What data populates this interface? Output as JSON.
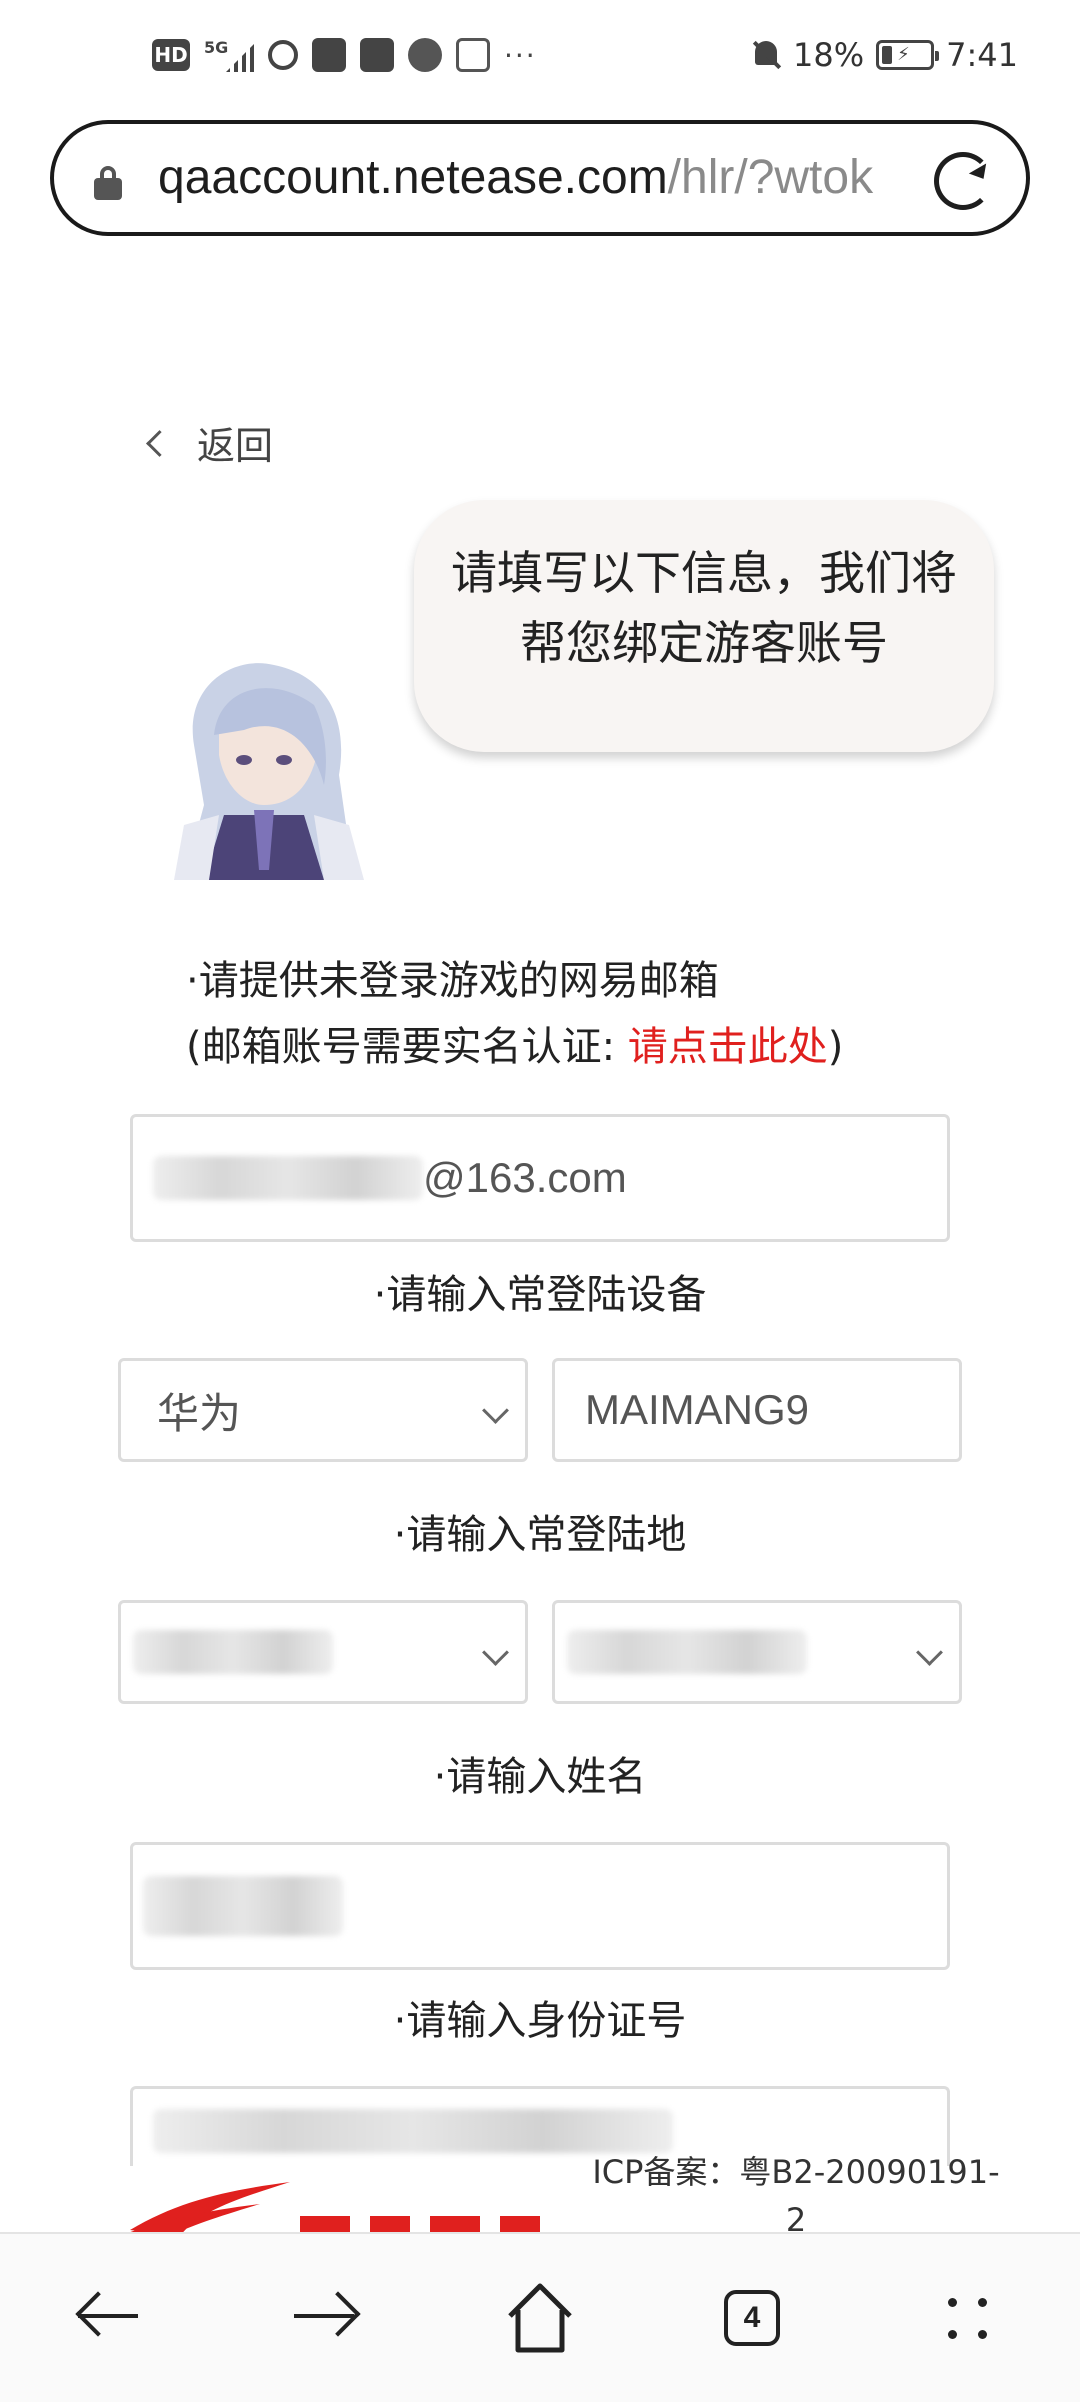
{
  "status_bar": {
    "battery": "18%",
    "time": "7:41",
    "network": "5G",
    "hd": "HD",
    "more": "···"
  },
  "browser": {
    "url_host": "qaaccount.netease.com",
    "url_path": "/hlr/?wtok",
    "tab_count": "4"
  },
  "page": {
    "back_label": "返回",
    "bubble_text": "请填写以下信息，我们将帮您绑定游客账号",
    "email_prompt_line1": "·请提供未登录游戏的网易邮箱",
    "email_prompt_line2_prefix": "(邮箱账号需要实名认证: ",
    "email_prompt_link": "请点击此处",
    "email_prompt_line2_suffix": ")",
    "email_value": "@163.com",
    "device_label": "·请输入常登陆设备",
    "device_brand": "华为",
    "device_model": "MAIMANG9",
    "location_label": "·请输入常登陆地",
    "name_label": "·请输入姓名",
    "id_label": "·请输入身份证号",
    "icp": "ICP备案：粤B2-20090191-2"
  },
  "colors": {
    "link": "#e0201e",
    "bubble": "#f8f5f3",
    "border": "#dcdcdc"
  }
}
